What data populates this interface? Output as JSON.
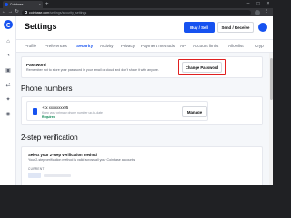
{
  "browser": {
    "tab_title": "Coinbase",
    "tab_close_glyph": "×",
    "new_tab_glyph": "+",
    "url_host": "coinbase.com",
    "url_path": "/settings/security_settings",
    "window_controls": [
      "–",
      "□",
      "×"
    ],
    "nav_glyphs": {
      "back": "←",
      "forward": "→",
      "reload": "↻",
      "menu": "⋮"
    }
  },
  "header": {
    "title": "Settings",
    "buy_sell": "Buy / Sell",
    "send_receive": "Send / Receive"
  },
  "rail_icons": [
    "home-icon",
    "portfolio-icon",
    "assets-icon",
    "trade-icon",
    "rewards-icon",
    "notifications-icon"
  ],
  "rail_glyphs": [
    "⌂",
    "◔",
    "▣",
    "⇄",
    "✦",
    "◉"
  ],
  "tabs": [
    {
      "label": "Profile",
      "active": false
    },
    {
      "label": "Preferences",
      "active": false
    },
    {
      "label": "Security",
      "active": true
    },
    {
      "label": "Activity",
      "active": false
    },
    {
      "label": "Privacy",
      "active": false
    },
    {
      "label": "Payment methods",
      "active": false
    },
    {
      "label": "API",
      "active": false
    },
    {
      "label": "Account limits",
      "active": false
    },
    {
      "label": "Allowlist",
      "active": false
    },
    {
      "label": "Cryp",
      "active": false
    }
  ],
  "password": {
    "title": "Password",
    "description": "Remember not to store your password in your email or cloud and don't share it with anyone.",
    "button": "Change Password"
  },
  "phone": {
    "heading": "Phone numbers",
    "number": "+xx xxxxxxxx95",
    "description": "Keep your primary phone number up-to-date",
    "status": "Required",
    "manage_button": "Manage"
  },
  "two_step": {
    "heading": "2-step verification",
    "title": "Select your 2-step verification method",
    "description": "Your 2-step verification method is valid across all your Coinbase accounts",
    "current_label": "CURRENT"
  },
  "colors": {
    "brand": "#1652f0",
    "highlight": "#e02020",
    "required_green": "#098551"
  }
}
